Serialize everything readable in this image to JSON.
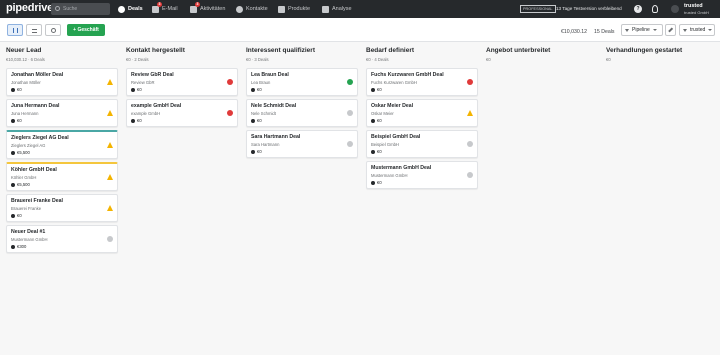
{
  "topbar": {
    "logo": "pipedrive",
    "search_placeholder": "Suche",
    "nav": [
      {
        "label": "Deals"
      },
      {
        "label": "E-Mail",
        "badge": "3"
      },
      {
        "label": "Aktivitäten",
        "badge": "3"
      },
      {
        "label": "Kontakte"
      },
      {
        "label": "Produkte"
      },
      {
        "label": "Analyse"
      }
    ],
    "plan_badge": "PROFESSIONAL",
    "trial_text": "13 Tage Testversion verbleibend",
    "user_name": "trusted",
    "user_company": "trusted GmbH"
  },
  "toolbar": {
    "add_label": "+ Geschäft",
    "total_value": "€10,030.12",
    "deal_count": "15 Deals",
    "pipeline_label": "Pipeline",
    "owner_filter": "trusted"
  },
  "columns": [
    {
      "title": "Neuer Lead",
      "meta": "€10,030.12 · 6 Deals",
      "cards": [
        {
          "title": "Jonathan Möller Deal",
          "sub": "Jonathan Möller",
          "value": "€0",
          "status": "warning"
        },
        {
          "title": "Juna Hermann Deal",
          "sub": "Juna Hermann",
          "value": "€0",
          "status": "warning"
        },
        {
          "title": "Zieglers Ziegel AG Deal",
          "sub": "Zieglers Ziegel AG",
          "value": "€5,500",
          "status": "warning",
          "stripe": "teal"
        },
        {
          "title": "Köhler GmbH Deal",
          "sub": "Köhler GmbH",
          "value": "€5,500",
          "status": "warning",
          "stripe": "yellow"
        },
        {
          "title": "Brauerei Franke Deal",
          "sub": "Brauerei Franke",
          "value": "€0",
          "status": "warning"
        },
        {
          "title": "Neuer Deal #1",
          "sub": "Mustermann GmbH",
          "value": "€300",
          "status": "gray"
        }
      ]
    },
    {
      "title": "Kontakt hergestellt",
      "meta": "€0 · 2 Deals",
      "cards": [
        {
          "title": "Review GbR Deal",
          "sub": "Review GbR",
          "value": "€0",
          "status": "red"
        },
        {
          "title": "example GmbH Deal",
          "sub": "example GmbH",
          "value": "€0",
          "status": "red"
        }
      ]
    },
    {
      "title": "Interessent qualifiziert",
      "meta": "€0 · 3 Deals",
      "cards": [
        {
          "title": "Lea Braun Deal",
          "sub": "Lea Braun",
          "value": "€0",
          "status": "green"
        },
        {
          "title": "Nele Schmidt Deal",
          "sub": "Nele Schmidt",
          "value": "€0",
          "status": "gray"
        },
        {
          "title": "Sara Hartmann Deal",
          "sub": "Sara Hartmann",
          "value": "€0",
          "status": "gray"
        }
      ]
    },
    {
      "title": "Bedarf definiert",
      "meta": "€0 · 4 Deals",
      "cards": [
        {
          "title": "Fuchs Kurzwaren GmbH Deal",
          "sub": "Fuchs Kurzwaren GmbH",
          "value": "€0",
          "status": "red"
        },
        {
          "title": "Oskar Meier Deal",
          "sub": "Oskar Meier",
          "value": "€0",
          "status": "warning"
        },
        {
          "title": "Beispiel GmbH Deal",
          "sub": "Beispiel GmbH",
          "value": "€0",
          "status": "gray"
        },
        {
          "title": "Mustermann GmbH Deal",
          "sub": "Mustermann GmbH",
          "value": "€0",
          "status": "gray"
        }
      ]
    },
    {
      "title": "Angebot unterbreitet",
      "meta": "€0",
      "cards": []
    },
    {
      "title": "Verhandlungen gestartet",
      "meta": "€0",
      "cards": []
    }
  ]
}
